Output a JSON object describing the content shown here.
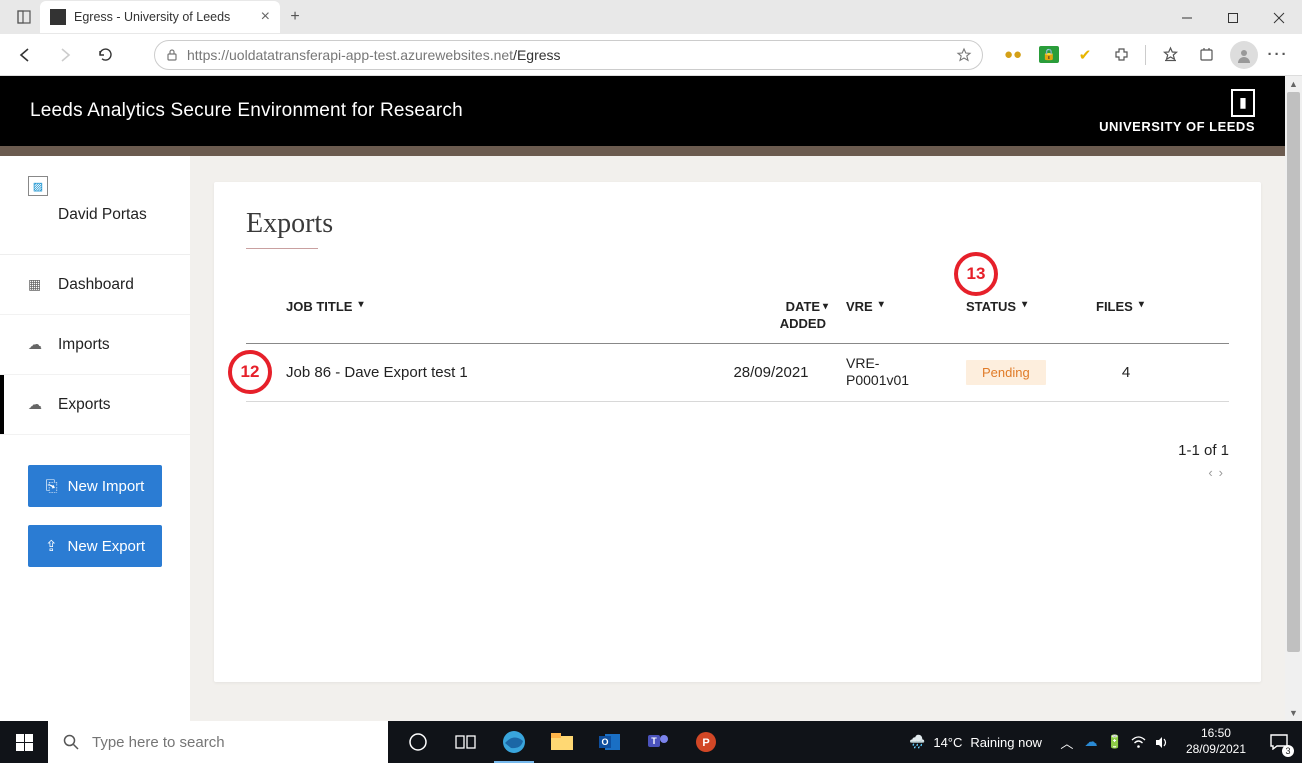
{
  "browser": {
    "tab_title": "Egress - University of Leeds",
    "url_host": "https://uoldatatransferapi-app-test.azurewebsites.net",
    "url_path": "/Egress"
  },
  "header": {
    "site_title": "Leeds Analytics Secure Environment for Research",
    "uni_name": "UNIVERSITY OF LEEDS"
  },
  "sidebar": {
    "user_name": "David Portas",
    "items": [
      {
        "label": "Dashboard"
      },
      {
        "label": "Imports"
      },
      {
        "label": "Exports"
      }
    ],
    "new_import": "New Import",
    "new_export": "New Export"
  },
  "page": {
    "title": "Exports",
    "columns": {
      "job": "JOB TITLE",
      "date1": "DATE",
      "date2": "ADDED",
      "vre": "VRE",
      "status": "STATUS",
      "files": "FILES"
    },
    "rows": [
      {
        "job": "Job 86 - Dave Export test 1",
        "date": "28/09/2021",
        "vre1": "VRE-",
        "vre2": "P0001v01",
        "status": "Pending",
        "files": "4"
      }
    ],
    "pager_text": "1-1 of 1"
  },
  "annotations": {
    "a12": "12",
    "a13": "13"
  },
  "taskbar": {
    "search_placeholder": "Type here to search",
    "weather_temp": "14°C",
    "weather_text": "Raining now",
    "time": "16:50",
    "date": "28/09/2021",
    "notif_count": "3"
  }
}
